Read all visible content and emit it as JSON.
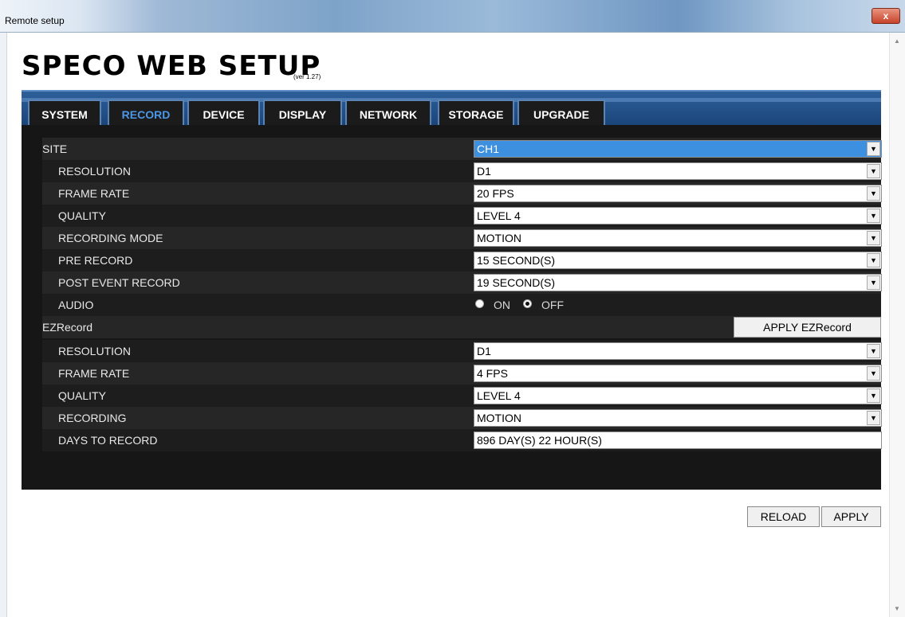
{
  "window": {
    "title": "Remote setup",
    "close_label": "x"
  },
  "header": {
    "title": "SPECO WEB SETUP",
    "version": "(ver 1.27)"
  },
  "tabs": [
    {
      "label": "SYSTEM"
    },
    {
      "label": "RECORD"
    },
    {
      "label": "DEVICE"
    },
    {
      "label": "DISPLAY"
    },
    {
      "label": "NETWORK"
    },
    {
      "label": "STORAGE"
    },
    {
      "label": "UPGRADE"
    }
  ],
  "active_tab": "RECORD",
  "record": {
    "site_label": "SITE",
    "site_value": "CH1",
    "resolution_label": "RESOLUTION",
    "resolution_value": "D1",
    "frame_rate_label": "FRAME RATE",
    "frame_rate_value": "20 FPS",
    "quality_label": "QUALITY",
    "quality_value": "LEVEL 4",
    "recording_mode_label": "RECORDING MODE",
    "recording_mode_value": "MOTION",
    "pre_record_label": "PRE RECORD",
    "pre_record_value": "15 SECOND(S)",
    "post_event_label": "POST EVENT RECORD",
    "post_event_value": "19 SECOND(S)",
    "audio_label": "AUDIO",
    "audio_on_label": "ON",
    "audio_off_label": "OFF",
    "audio_selected": "OFF"
  },
  "ezrecord": {
    "section_label": "EZRecord",
    "apply_label": "APPLY EZRecord",
    "resolution_label": "RESOLUTION",
    "resolution_value": "D1",
    "frame_rate_label": "FRAME RATE",
    "frame_rate_value": "4 FPS",
    "quality_label": "QUALITY",
    "quality_value": "LEVEL 4",
    "recording_label": "RECORDING",
    "recording_value": "MOTION",
    "days_label": "DAYS TO RECORD",
    "days_value": "896 DAY(S) 22 HOUR(S)"
  },
  "footer": {
    "reload_label": "RELOAD",
    "apply_label": "APPLY"
  },
  "colors": {
    "panel_bg": "#161616",
    "tab_bar": "#1a4478",
    "active_tab_text": "#4b97e6",
    "selected_select": "#3d8fe0"
  }
}
